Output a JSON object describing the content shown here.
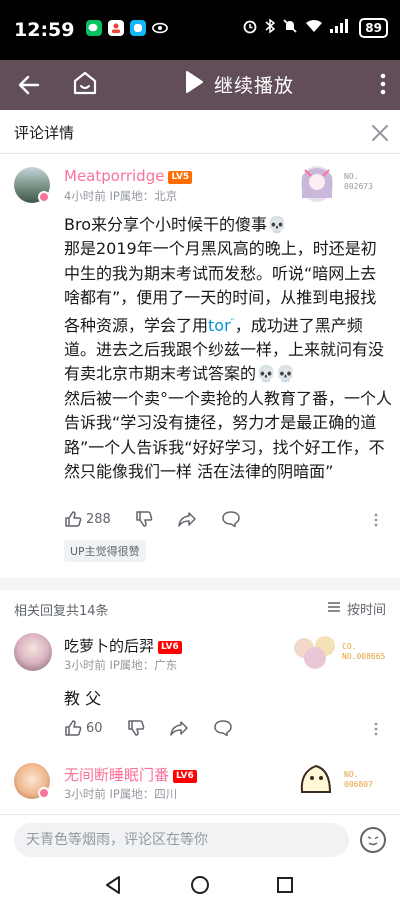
{
  "status_bar": {
    "time": "12:59",
    "battery": "89",
    "left_icons": [
      "wechat-icon",
      "user-app-icon",
      "qq-icon",
      "eye-icon"
    ],
    "right_icons": [
      "alarm-icon",
      "bluetooth-icon",
      "mute-icon",
      "wifi-icon",
      "signal-icon"
    ]
  },
  "top_bar": {
    "play_label": "继续播放",
    "background": "#614e59"
  },
  "detail_header": {
    "title": "评论详情"
  },
  "main_comment": {
    "username": "Meatporridge",
    "level": "LV5",
    "username_color": "#fb7299",
    "time": "4小时前",
    "ip": "IP属地：北京",
    "badge_no": "NO.",
    "badge_num": "002673",
    "body_before_link": "Bro来分享个小时候干的傻事💀\n那是2019年一个月黑风高的晚上，时还是初中生的我为期末考试而发愁。听说“暗网上去啥都有”，便用了一天的时间，从推到电报找各种资源，学会了用",
    "link_text": "tor",
    "body_after_link": "，成功进了黑产频道。进去之后我跟个纱兹一样，上来就问有没有卖北京市期末考试答案的💀💀\n然后被一个卖°一个卖抢的人教育了番，一个人告诉我“学习没有捷径，努力才是最正确的道路”一个人告诉我“好好学习，找个好工作，不然只能像我们一样 活在法律的阴暗面”",
    "like_count": "288",
    "up_tag": "UP主觉得很赞"
  },
  "replies_header": {
    "count_label": "相关回复共14条",
    "sort_label": "按时间"
  },
  "replies": [
    {
      "username": "吃萝卜的后羿",
      "level": "LV6",
      "username_color": "#18191c",
      "time": "3小时前",
      "ip": "IP属地：广东",
      "badge_no": "CO.",
      "badge_num": "NO.008665",
      "text": "教 父",
      "like_count": "60"
    },
    {
      "username": "无间断睡眠门番",
      "level": "LV6",
      "username_color": "#fb7299",
      "time": "3小时前",
      "ip": "IP属地：四川",
      "badge_no": "NO.",
      "badge_num": "006807"
    }
  ],
  "input_bar": {
    "placeholder": "天青色等烟雨，评论区在等你"
  },
  "colors": {
    "accent_pink": "#fb7299",
    "link_blue": "#0093d6",
    "meta_grey": "#9499a0"
  }
}
